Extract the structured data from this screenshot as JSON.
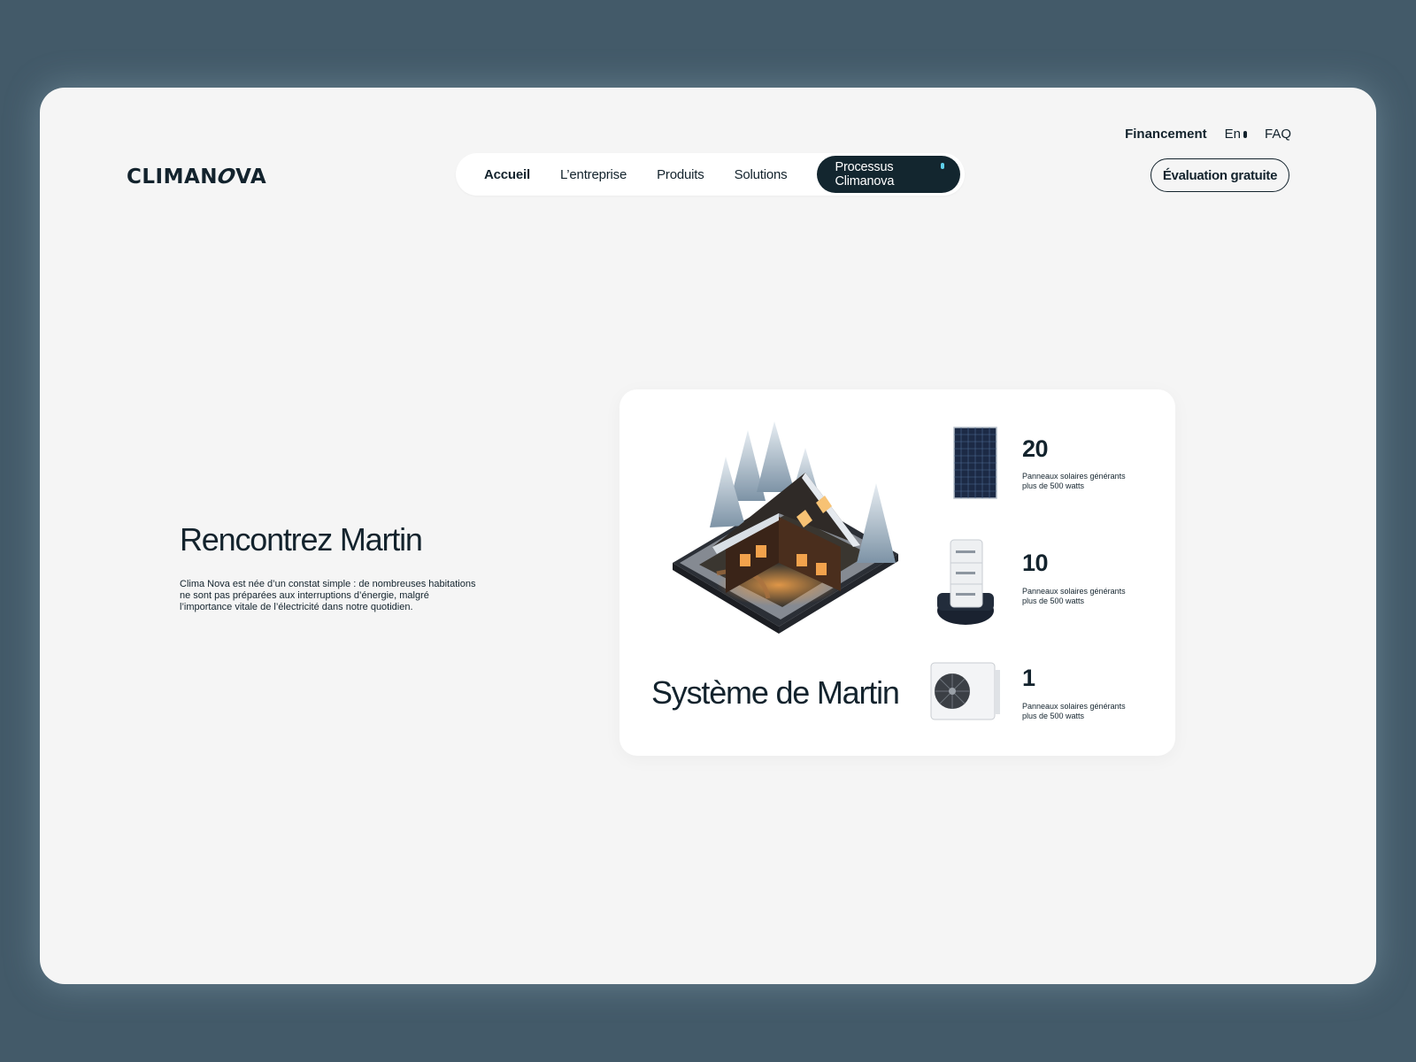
{
  "brand": {
    "logo_pre": "CLIMAN",
    "logo_o": "O",
    "logo_post": "VA"
  },
  "top_links": {
    "financing": "Financement",
    "language": "En",
    "faq": "FAQ"
  },
  "nav": {
    "items": [
      "Accueil",
      "L’entreprise",
      "Produits",
      "Solutions"
    ],
    "process": "Processus Climanova"
  },
  "cta": "Évaluation gratuite",
  "intro": {
    "title": "Rencontrez Martin",
    "text": "Clima Nova est née d’un constat simple : de nombreuses habitations ne sont pas préparées aux interruptions d’énergie, malgré l’importance vitale de l’électricité dans notre quotidien."
  },
  "system": {
    "title": "Système de Martin",
    "stats": [
      {
        "icon": "solar-panel-icon",
        "value": "20",
        "desc": "Panneaux solaires générants plus de 500 watts"
      },
      {
        "icon": "battery-icon",
        "value": "10",
        "desc": "Panneaux solaires générants plus de 500 watts"
      },
      {
        "icon": "heat-pump-icon",
        "value": "1",
        "desc": "Panneaux solaires générants plus de 500 watts"
      }
    ]
  },
  "colors": {
    "background": "#435a69",
    "frame": "#f5f5f5",
    "ink": "#13232d",
    "accent": "#5fd0ea"
  }
}
